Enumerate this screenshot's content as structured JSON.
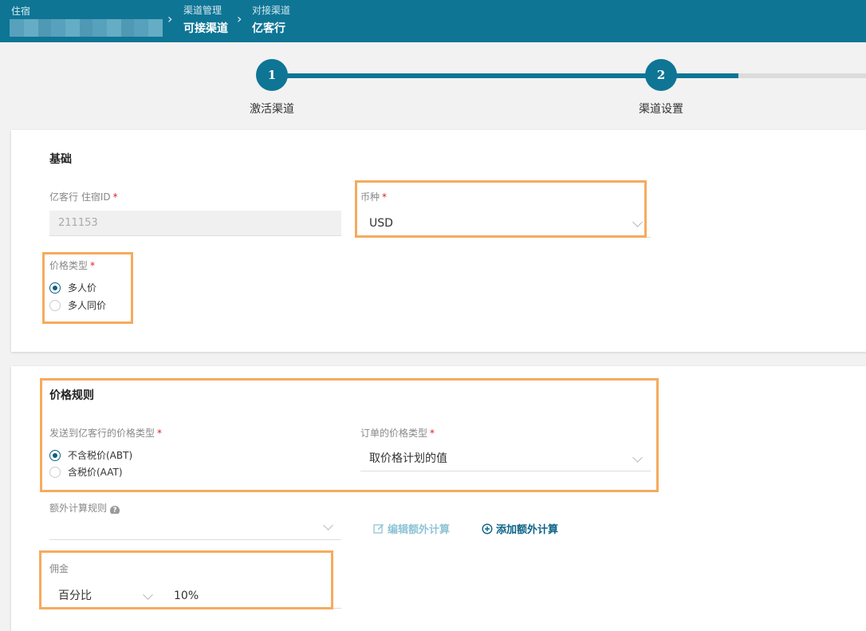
{
  "header": {
    "hotel_label": "住宿",
    "crumbs": [
      {
        "small": "渠道管理",
        "big": "可接渠道"
      },
      {
        "small": "对接渠道",
        "big": "亿客行"
      }
    ]
  },
  "stepper": {
    "steps": [
      {
        "number": "1",
        "label": "激活渠道"
      },
      {
        "number": "2",
        "label": "渠道设置"
      }
    ]
  },
  "basic": {
    "title": "基础",
    "hotel_id_label": "亿客行 住宿ID",
    "hotel_id_value": "211153",
    "currency_label": "币种",
    "currency_value": "USD",
    "price_type_label": "价格类型",
    "price_type_options": [
      "多人价",
      "多人同价"
    ],
    "price_type_selected": "多人价"
  },
  "pricing": {
    "title": "价格规则",
    "send_price_label": "发送到亿客行的价格类型",
    "send_price_options": [
      "不含税价(ABT)",
      "含税价(AAT)"
    ],
    "send_price_selected": "不含税价(ABT)",
    "order_price_label": "订单的价格类型",
    "order_price_value": "取价格计划的值",
    "extra_calc_label": "额外计算规则",
    "help_glyph": "?",
    "edit_extra_label": "编辑额外计算",
    "add_extra_label": "添加额外计算",
    "commission_label": "佣金",
    "commission_type": "百分比",
    "commission_value": "10%"
  },
  "required_mark": "*",
  "colors": {
    "brand": "#0e7595",
    "highlight": "#f5ab5e",
    "link_active": "#0e6488",
    "link_disabled": "#8ec4d6",
    "required": "#e02020"
  }
}
